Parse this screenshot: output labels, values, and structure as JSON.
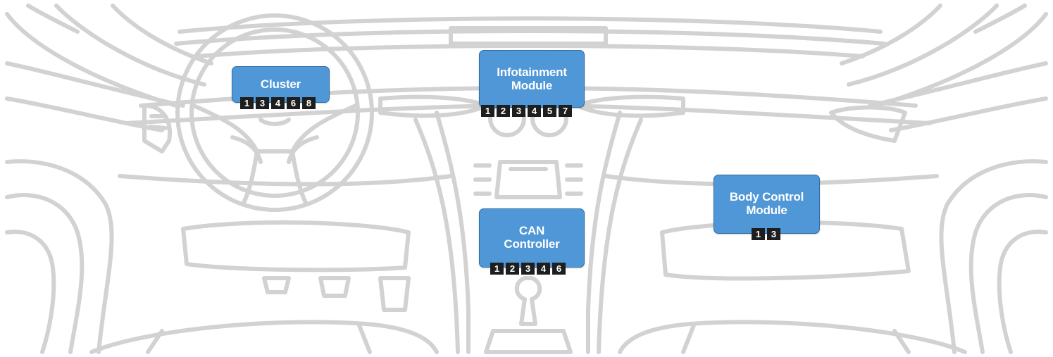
{
  "colors": {
    "line": "#d2d2d2",
    "module_fill": "#4f97d6",
    "module_border": "#2f6ea8",
    "badge_fill": "#1e1e1e",
    "badge_text": "#ffffff"
  },
  "modules": {
    "cluster": {
      "title": "Cluster",
      "badges": [
        "1",
        "3",
        "4",
        "6",
        "8"
      ]
    },
    "infotainment": {
      "title": "Infotainment\nModule",
      "badges": [
        "1",
        "2",
        "3",
        "4",
        "5",
        "7"
      ]
    },
    "can_controller": {
      "title": "CAN\nController",
      "badges": [
        "1",
        "2",
        "3",
        "4",
        "6"
      ]
    },
    "body_control": {
      "title": "Body Control\nModule",
      "badges": [
        "1",
        "3"
      ]
    }
  }
}
